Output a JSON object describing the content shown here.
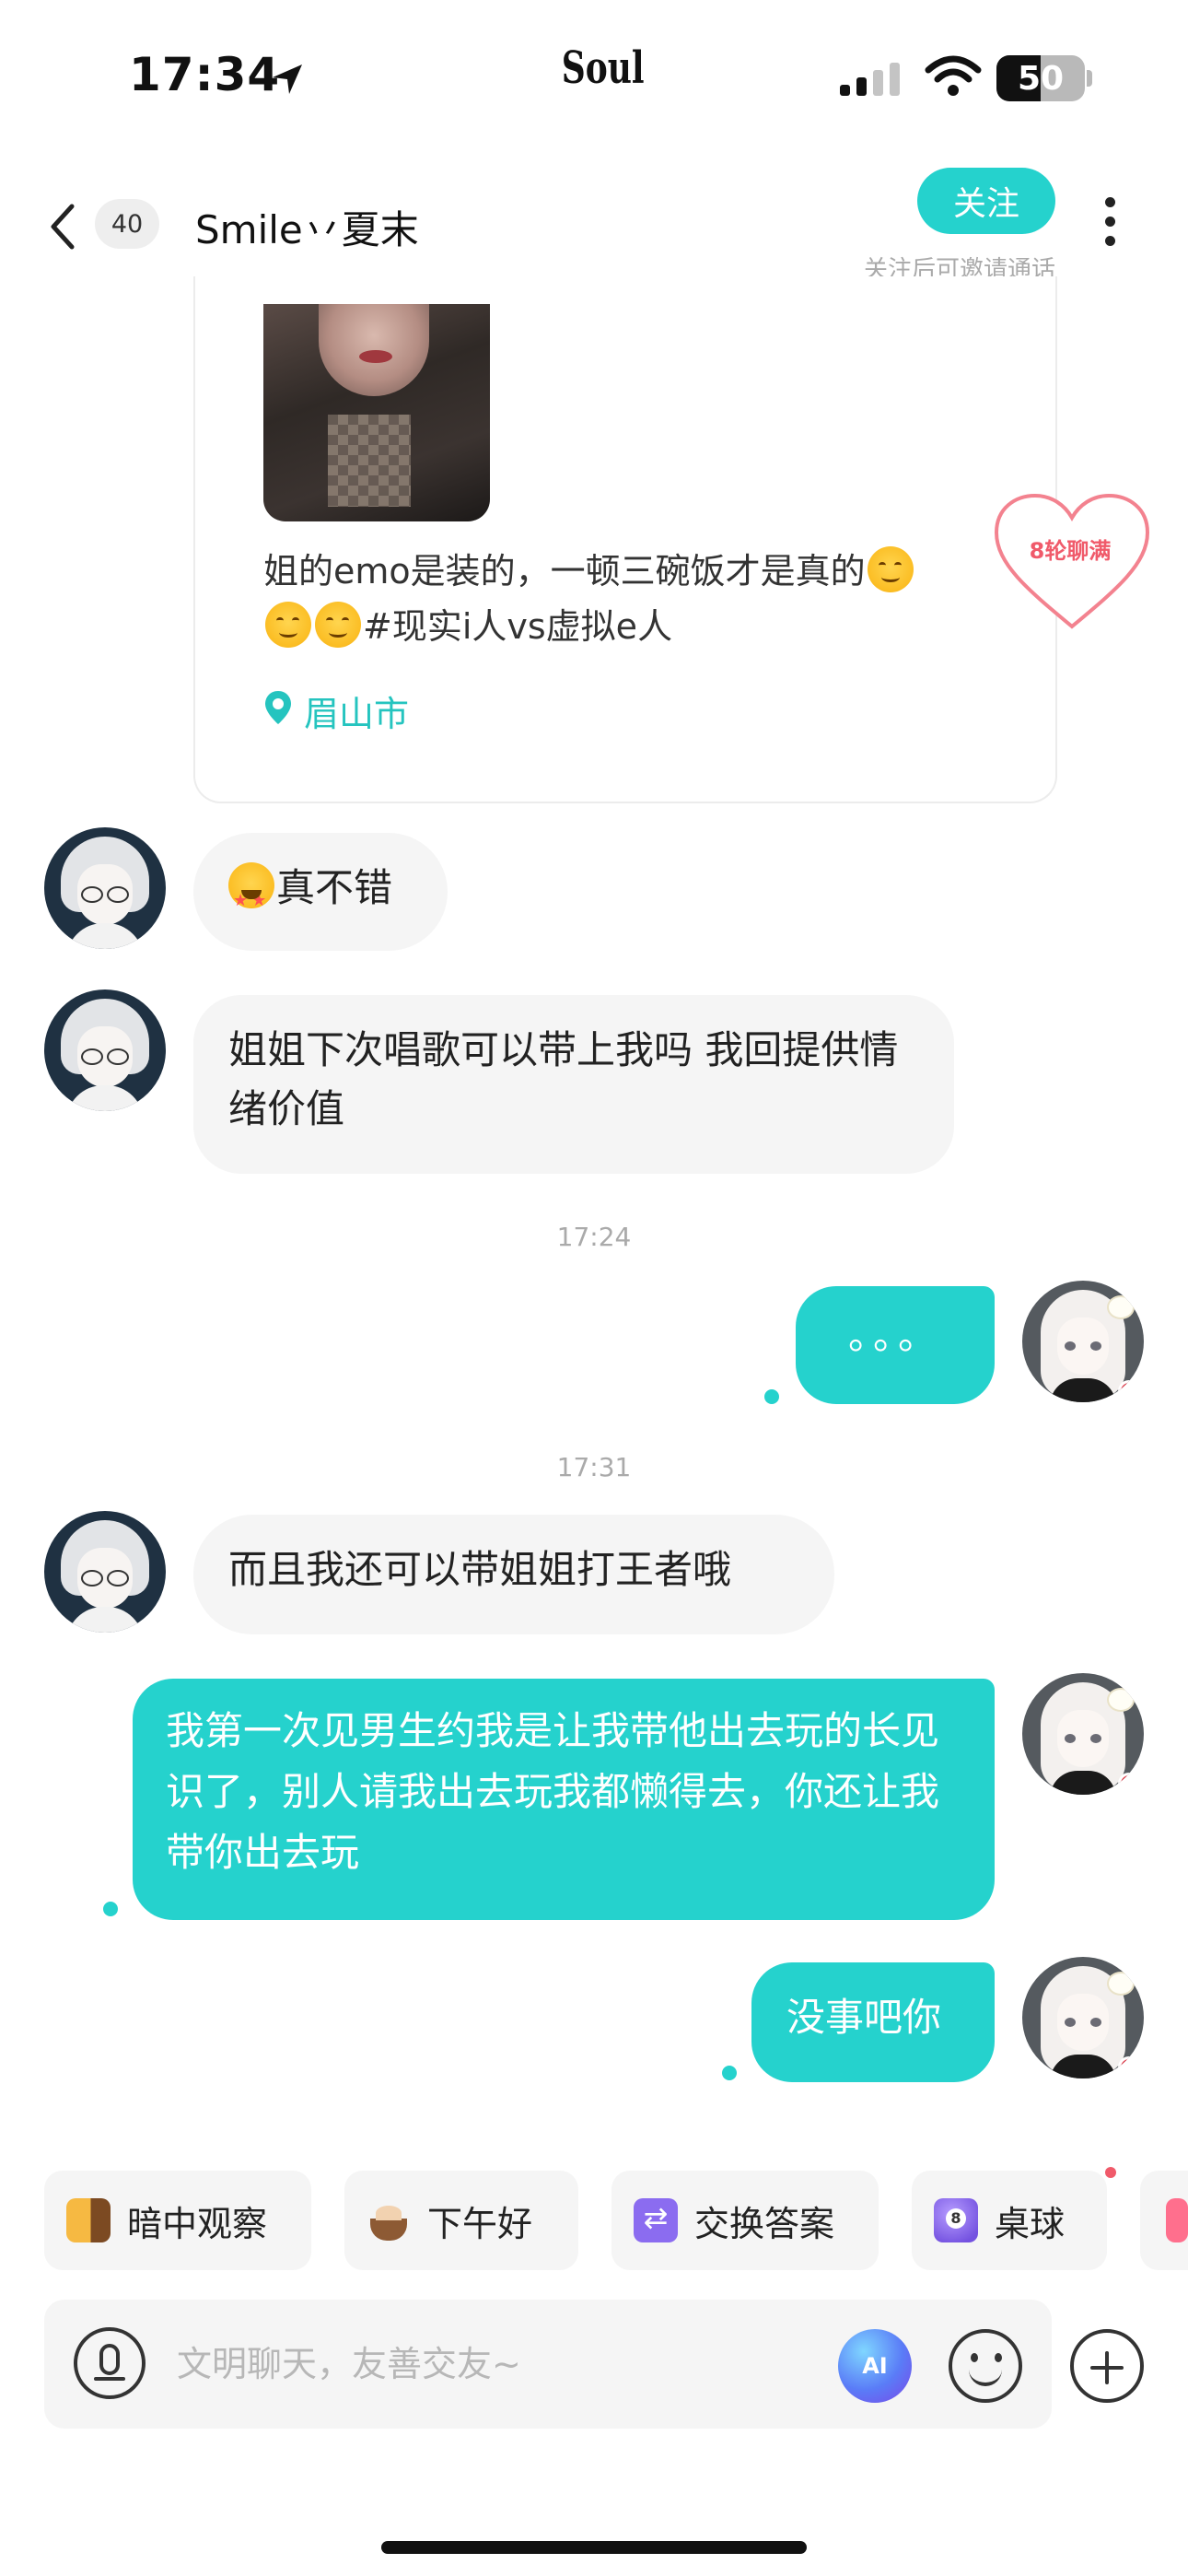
{
  "status_bar": {
    "time": "17:34",
    "app_brand": "Soul",
    "battery": "50",
    "battery_level_percent": 50
  },
  "header": {
    "unread_count": "40",
    "contact_name": "Smile丷夏末",
    "follow_label": "关注",
    "follow_hint": "关注后可邀请通话"
  },
  "post": {
    "text_part1": "姐的emo是装的，一顿三碗饭才是真的",
    "text_part2": "#现实i人vs虚拟e人",
    "location": "眉山市",
    "chat_badge": "8轮聊满"
  },
  "messages": [
    {
      "side": "in",
      "text": "真不错",
      "emoji": "star-struck-emoji"
    },
    {
      "side": "in",
      "text": "姐姐下次唱歌可以带上我吗  我回提供情绪价值"
    },
    {
      "side": "time",
      "text": "17:24"
    },
    {
      "side": "out",
      "text": "。。。"
    },
    {
      "side": "time",
      "text": "17:31"
    },
    {
      "side": "in",
      "text": "而且我还可以带姐姐打王者哦"
    },
    {
      "side": "out",
      "text": "我第一次见男生约我是让我带他出去玩的长见识了，别人请我出去玩我都懒得去，你还让我带你出去玩"
    },
    {
      "side": "out",
      "text": "没事吧你"
    }
  ],
  "quick_replies": [
    {
      "label": "暗中观察",
      "icon": "peek-icon"
    },
    {
      "label": "下午好",
      "icon": "tea-icon"
    },
    {
      "label": "交换答案",
      "icon": "swap-icon"
    },
    {
      "label": "桌球",
      "icon": "billiards-icon"
    }
  ],
  "input": {
    "placeholder": "文明聊天，友善交友~",
    "ai_label": "AI"
  },
  "colors": {
    "accent": "#25d2cd",
    "bubble_in": "#f5f5f5",
    "badge_red": "#f05a6a"
  }
}
